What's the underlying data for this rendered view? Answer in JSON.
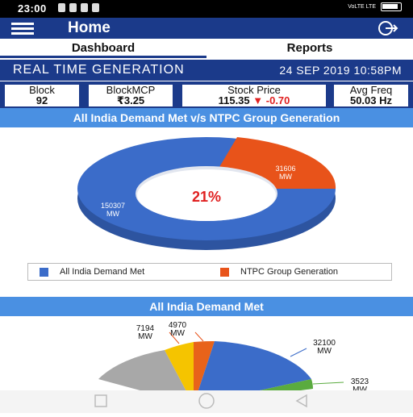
{
  "status": {
    "time": "23:00",
    "signal": "VoLTE LTE"
  },
  "appbar": {
    "title": "Home"
  },
  "tabs": [
    {
      "label": "Dashboard"
    },
    {
      "label": "Reports"
    }
  ],
  "header": {
    "title": "REAL TIME GENERATION",
    "datetime": "24 SEP 2019 10:58PM"
  },
  "stats": {
    "block": {
      "label": "Block",
      "value": "92"
    },
    "mcp": {
      "label": "BlockMCP",
      "value": "₹3.25"
    },
    "stock": {
      "label": "Stock Price",
      "value": "115.35",
      "change": "-0.70"
    },
    "freq": {
      "label": "Avg Freq",
      "value": "50.03 Hz"
    }
  },
  "section1": {
    "title": "All India Demand Met v/s NTPC Group Generation"
  },
  "donut": {
    "center_label": "21%",
    "slices": [
      {
        "label": "All India Demand Met",
        "value": 150307,
        "text": "150307",
        "unit": "MW",
        "color": "#3b6cc9"
      },
      {
        "label": "NTPC Group Generation",
        "value": 31606,
        "text": "31606",
        "unit": "MW",
        "color": "#e8531a"
      }
    ]
  },
  "section2": {
    "title": "All India Demand Met"
  },
  "pie": {
    "labels": [
      {
        "text": "7194",
        "unit": "MW"
      },
      {
        "text": "4970",
        "unit": "MW"
      },
      {
        "text": "32100",
        "unit": "MW"
      },
      {
        "text": "3523",
        "unit": "MW"
      }
    ]
  },
  "colors": {
    "primary": "#1b3a8a",
    "accent": "#4a90e2",
    "orange": "#e8531a",
    "blue": "#3b6cc9",
    "gray": "#a8a8a8",
    "yellow": "#f5c400",
    "green": "#5aab3f"
  }
}
